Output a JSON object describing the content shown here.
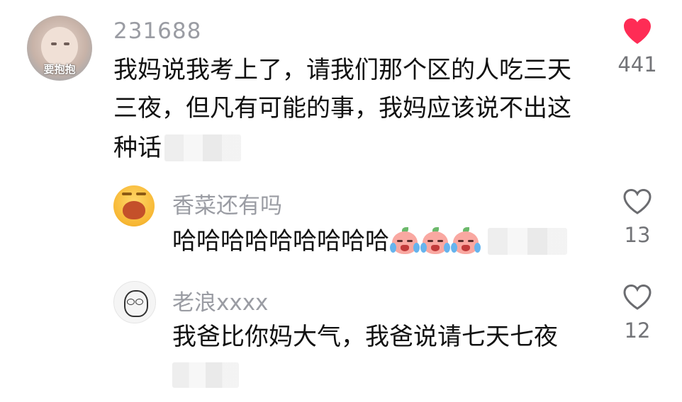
{
  "comments": [
    {
      "username": "231688",
      "avatar_text": "要抱抱",
      "text_lines": [
        "我妈说我考上了，请我们那个区的人吃三天",
        "三夜，但凡有可能的事，我妈应该说不出这",
        "种话"
      ],
      "like_count": "441",
      "liked": true,
      "heart_color": "#fe2c55"
    },
    {
      "username": "香菜还有吗",
      "text": "哈哈哈哈哈哈哈哈哈",
      "emoji": [
        "crying-emoji",
        "crying-emoji",
        "crying-emoji"
      ],
      "like_count": "13",
      "liked": false
    },
    {
      "username": "老浪xxxx",
      "text": "我爸比你妈大气，我爸说请七天七夜",
      "like_count": "12",
      "liked": false
    }
  ]
}
